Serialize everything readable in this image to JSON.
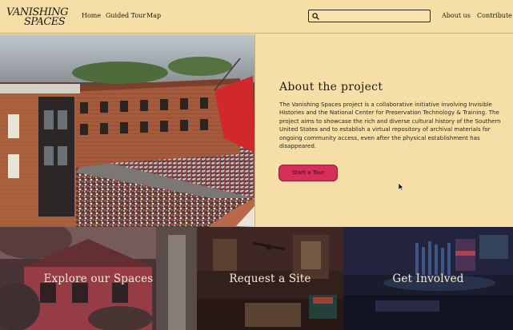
{
  "header": {
    "logo_line1": "VANISHING",
    "logo_line2": "SPACES",
    "nav": [
      "Home",
      "Guided Tour",
      "Map"
    ],
    "search_placeholder": "",
    "right_nav": [
      "About us",
      "Contribute"
    ]
  },
  "about": {
    "title": "About the project",
    "body": "The Vanishing Spaces project is a collaborative initiative involving Invisible Histories and the National Center for Preservation Technology & Training. The project aims to showcase the rich and diverse cultural history of the Southern United States and to establish a virtual repository of archival materials for ongoing community access, even after the physical establishment has disappeared.",
    "cta": "Start a Tour"
  },
  "cards": [
    "Explore our Spaces",
    "Request a Site",
    "Get Involved"
  ],
  "colors": {
    "background": "#f6dfa6",
    "accent": "#d62f5a",
    "text": "#1e1a14"
  }
}
